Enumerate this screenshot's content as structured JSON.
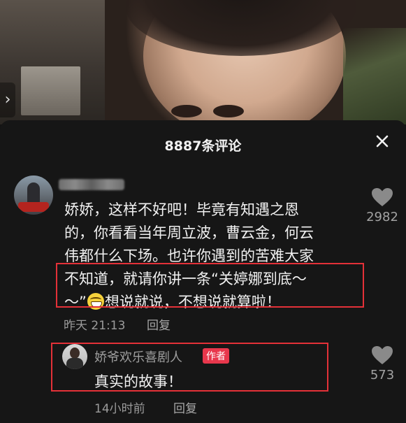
{
  "video": {
    "side_arrow": "›"
  },
  "header": {
    "title": "8887条评论",
    "close_icon": "close-icon"
  },
  "comments": [
    {
      "author": "",
      "lines": [
        "娇娇，这样不好吧！毕竟有知遇之恩",
        "的，你看看当年周立波，曹云金，何云",
        "伟都什么下场。也许你遇到的苦难大家",
        "不知道，就请你讲一条“关婷娜到底～",
        "～”",
        "想说就说，不想说就算啦！"
      ],
      "time": "昨天 21:13",
      "reply_label": "回复",
      "likes": "2982"
    }
  ],
  "reply": {
    "author": "娇爷欢乐喜剧人",
    "tag": "作者",
    "text": "真实的故事！",
    "time": "14小时前",
    "reply_label": "回复",
    "likes": "573"
  },
  "colors": {
    "highlight_box": "#e43138",
    "author_tag": "#e8374c",
    "background": "#161616"
  }
}
